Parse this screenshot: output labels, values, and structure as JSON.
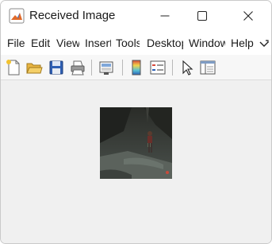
{
  "window": {
    "title": "Received Image",
    "icon": "matlab-figure-icon",
    "controls": [
      "minimize-icon",
      "maximize-icon",
      "close-icon"
    ]
  },
  "menubar": {
    "items": [
      {
        "label": "File"
      },
      {
        "label": "Edit"
      },
      {
        "label": "View"
      },
      {
        "label": "Insert"
      },
      {
        "label": "Tools"
      },
      {
        "label": "Desktop"
      },
      {
        "label": "Window"
      },
      {
        "label": "Help"
      }
    ],
    "overflow_icon": "chevron-more-icon"
  },
  "toolbar": {
    "buttons": [
      {
        "name": "new-figure",
        "icon": "new-file-icon"
      },
      {
        "name": "open-file",
        "icon": "open-folder-icon"
      },
      {
        "name": "save-figure",
        "icon": "save-disk-icon"
      },
      {
        "name": "print-figure",
        "icon": "printer-icon"
      },
      {
        "name": "link-plot",
        "icon": "link-plot-icon"
      },
      {
        "name": "insert-colorbar",
        "icon": "colorbar-icon"
      },
      {
        "name": "insert-legend",
        "icon": "legend-icon"
      },
      {
        "name": "edit-plot",
        "icon": "pointer-icon"
      },
      {
        "name": "property-inspector",
        "icon": "property-inspector-icon"
      }
    ]
  },
  "figure": {
    "image_content": "dark night street scene photo with a standing person",
    "colors": {
      "background": "#f0f0f0",
      "accent": "#0064c8"
    }
  }
}
